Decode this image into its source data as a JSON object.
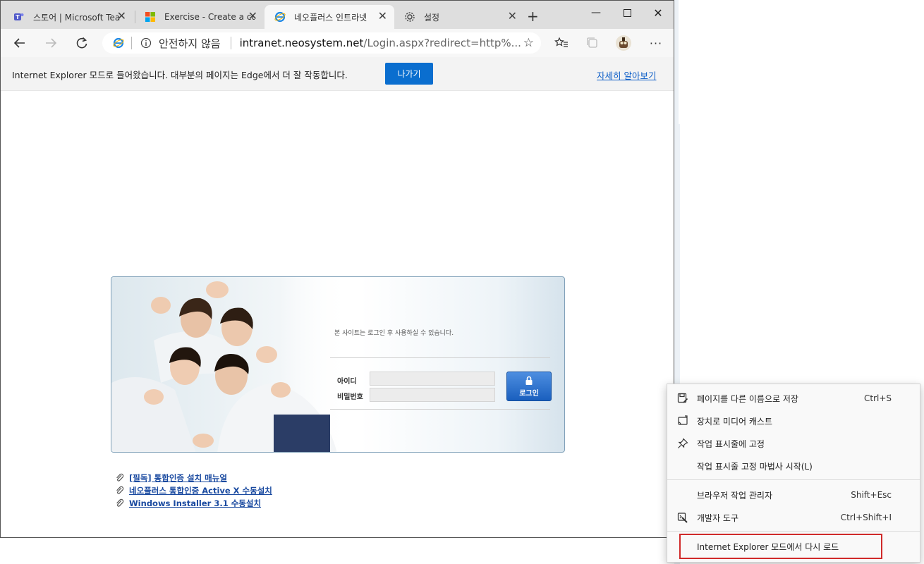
{
  "tabs": [
    {
      "label": "스토어 | Microsoft Tea",
      "icon": "teams-icon"
    },
    {
      "label": "Exercise - Create a cus",
      "icon": "microsoft-logo-icon"
    },
    {
      "label": "네오플러스 인트라넷",
      "icon": "ie-icon"
    },
    {
      "label": "설정",
      "icon": "gear-icon"
    }
  ],
  "address": {
    "security_text": "안전하지 않음",
    "url_host": "intranet.neosystem.net",
    "url_path": "/Login.aspx?redirect=http%..."
  },
  "iebar": {
    "message": "Internet Explorer 모드로 들어왔습니다. 대부분의 페이지는 Edge에서 더 잘 작동합니다.",
    "button": "나가기",
    "link": "자세히 알아보기"
  },
  "login": {
    "notice": "본 사이트는  로그인 후 사용하실 수 있습니다.",
    "id_label": "아이디",
    "pw_label": "비밀번호",
    "button": "로그인"
  },
  "downloads": [
    "[필독] 통합인증 설치 매뉴얼",
    "네오플러스 통합인증 Active X 수동설치",
    "Windows Installer 3.1 수동설치"
  ],
  "menu": {
    "items": [
      {
        "label": "페이지를 다른 이름으로 저장",
        "shortcut": "Ctrl+S",
        "icon": "save-icon"
      },
      {
        "label": "장치로 미디어 캐스트",
        "shortcut": "",
        "icon": "cast-icon"
      },
      {
        "label": "작업 표시줄에 고정",
        "shortcut": "",
        "icon": "pin-icon"
      },
      {
        "label": "작업 표시줄 고정 마법사 시작(L)",
        "shortcut": "",
        "icon": ""
      },
      {
        "label": "브라우저 작업 관리자",
        "shortcut": "Shift+Esc",
        "icon": ""
      },
      {
        "label": "개발자 도구",
        "shortcut": "Ctrl+Shift+I",
        "icon": "devtools-icon"
      },
      {
        "label": "Internet Explorer 모드에서 다시 로드",
        "shortcut": "",
        "icon": ""
      }
    ]
  },
  "colors": {
    "accent": "#0a6ecf",
    "highlight": "#d02a2a",
    "link": "#1a4aa0"
  }
}
